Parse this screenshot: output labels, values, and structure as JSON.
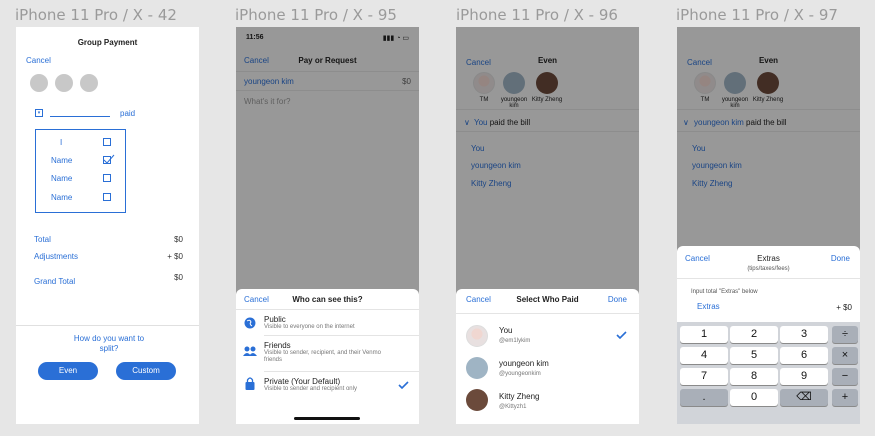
{
  "frames": [
    {
      "title": "iPhone 11 Pro / X - 42",
      "cancel": "Cancel",
      "header": "Group Payment",
      "paid_label": "paid",
      "list_rows": [
        {
          "name": "I",
          "checked": false
        },
        {
          "name": "Name",
          "checked": true
        },
        {
          "name": "Name",
          "checked": false
        },
        {
          "name": "Name",
          "checked": false
        }
      ],
      "totals": [
        {
          "label": "Total",
          "value": "$0"
        },
        {
          "label": "Adjustments",
          "value": "+ $0"
        },
        {
          "label": "Grand Total",
          "value": "$0"
        }
      ],
      "question": "How do you want to split?",
      "buttons": [
        "Even",
        "Custom"
      ]
    },
    {
      "title": "iPhone 11 Pro / X - 95",
      "status_time": "11:56",
      "cancel": "Cancel",
      "header": "Pay or Request",
      "recipient": "youngeon kim",
      "amount": "$0",
      "what_for": "What's it for?",
      "sheet": {
        "cancel": "Cancel",
        "title": "Who can see this?",
        "options": [
          {
            "icon": "globe-icon",
            "title": "Public",
            "desc": "Visible to everyone on the internet",
            "selected": false
          },
          {
            "icon": "friends-icon",
            "title": "Friends",
            "desc": "Visible to sender, recipient, and their Venmo friends",
            "selected": false
          },
          {
            "icon": "lock-icon",
            "title": "Private (Your Default)",
            "desc": "Visible to sender and recipient only",
            "selected": true
          }
        ]
      }
    },
    {
      "title": "iPhone 11 Pro / X - 96",
      "cancel": "Cancel",
      "header": "Even",
      "avatars": [
        "TM",
        "youngeon kim",
        "Kitty Zheng"
      ],
      "paid_who": "You",
      "paid_text": "paid the bill",
      "names": [
        "You",
        "youngeon kim",
        "Kitty Zheng"
      ],
      "sheet": {
        "cancel": "Cancel",
        "title": "Select Who Paid",
        "done": "Done",
        "people": [
          {
            "name": "You",
            "handle": "@em1lykim",
            "selected": true
          },
          {
            "name": "youngeon kim",
            "handle": "@youngeonkim",
            "selected": false
          },
          {
            "name": "Kitty Zheng",
            "handle": "@Kittyzh1",
            "selected": false
          }
        ]
      }
    },
    {
      "title": "iPhone 11 Pro / X - 97",
      "cancel": "Cancel",
      "header": "Even",
      "avatars": [
        "TM",
        "youngeon kim",
        "Kitty Zheng"
      ],
      "paid_who": "youngeon kim",
      "paid_text": "paid the bill",
      "names": [
        "You",
        "youngeon kim",
        "Kitty Zheng"
      ],
      "sheet": {
        "cancel": "Cancel",
        "title": "Extras",
        "subtitle": "(tips/taxes/fees)",
        "done": "Done",
        "prompt": "Input total \"Extras\" below",
        "field_label": "Extras",
        "field_value": "+ $0"
      },
      "keypad": [
        [
          "1",
          "2",
          "3",
          "÷"
        ],
        [
          "4",
          "5",
          "6",
          "×"
        ],
        [
          "7",
          "8",
          "9",
          "−"
        ],
        [
          ".",
          "0",
          "⌫",
          "+"
        ]
      ]
    }
  ],
  "colors": {
    "accent": "#2a6fd6",
    "background": "#e6e6e6"
  }
}
